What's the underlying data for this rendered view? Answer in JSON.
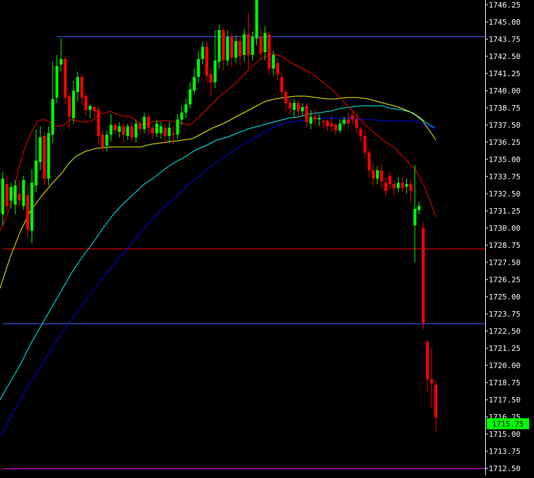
{
  "chart_data": {
    "type": "candlestick",
    "title": "",
    "xlabel": "",
    "ylabel": "",
    "ylim": [
      1712.0,
      1746.6
    ],
    "y_ticks": [
      "1746.25",
      "1745.00",
      "1743.75",
      "1742.50",
      "1741.25",
      "1740.00",
      "1738.75",
      "1737.50",
      "1736.25",
      "1735.00",
      "1733.75",
      "1732.50",
      "1731.25",
      "1730.00",
      "1728.75",
      "1727.50",
      "1726.25",
      "1725.00",
      "1723.75",
      "1722.50",
      "1721.25",
      "1720.00",
      "1718.75",
      "1717.50",
      "1716.25",
      "1715.00",
      "1713.75",
      "1712.50"
    ],
    "last_price": "1715.75",
    "grid": false,
    "colors": {
      "background": "#000000",
      "axis_text": "#ffffff",
      "up_candle": "#00ff00",
      "down_candle": "#ff0000",
      "last_price_bg": "#00ff00",
      "ma_red": "#ff0000",
      "ma_yellow": "#ffff00",
      "ma_cyan": "#00ffff",
      "ma_blue": "#0000ff"
    },
    "horizontal_levels": [
      {
        "value": 1743.95,
        "color": "#4a5cff",
        "start_index": 13
      },
      {
        "value": 1728.5,
        "color": "#ff0000",
        "start_index": 0
      },
      {
        "value": 1723.05,
        "color": "#4a5cff",
        "start_index": 0
      },
      {
        "value": 1712.5,
        "color": "#ff00ff",
        "start_index": 0
      }
    ],
    "candles": [
      [
        1731.0,
        1733.6,
        1730.2,
        1734.1
      ],
      [
        1733.2,
        1731.6,
        1731.2,
        1733.8
      ],
      [
        1732.0,
        1733.0,
        1731.4,
        1733.3
      ],
      [
        1731.7,
        1733.1,
        1731.0,
        1733.5
      ],
      [
        1732.5,
        1732.0,
        1731.6,
        1733.5
      ],
      [
        1731.6,
        1733.5,
        1731.3,
        1733.8
      ],
      [
        1732.4,
        1729.9,
        1729.3,
        1733.1
      ],
      [
        1729.8,
        1733.3,
        1728.9,
        1734.3
      ],
      [
        1733.1,
        1734.9,
        1732.6,
        1737.2
      ],
      [
        1734.8,
        1736.6,
        1734.2,
        1737.4
      ],
      [
        1736.7,
        1733.6,
        1733.1,
        1737.0
      ],
      [
        1733.6,
        1736.9,
        1733.1,
        1737.4
      ],
      [
        1736.8,
        1739.4,
        1736.2,
        1742.1
      ],
      [
        1739.5,
        1741.8,
        1739.1,
        1742.6
      ],
      [
        1741.9,
        1742.3,
        1741.4,
        1743.8
      ],
      [
        1742.3,
        1739.5,
        1739.0,
        1742.5
      ],
      [
        1739.6,
        1738.1,
        1737.2,
        1739.9
      ],
      [
        1738.0,
        1740.0,
        1737.6,
        1740.7
      ],
      [
        1739.9,
        1741.0,
        1739.2,
        1741.4
      ],
      [
        1741.0,
        1739.5,
        1739.0,
        1741.2
      ],
      [
        1739.6,
        1738.6,
        1738.2,
        1739.8
      ],
      [
        1738.6,
        1738.9,
        1738.0,
        1739.0
      ],
      [
        1738.8,
        1738.5,
        1738.1,
        1738.9
      ],
      [
        1738.6,
        1736.7,
        1736.1,
        1738.9
      ],
      [
        1736.8,
        1735.9,
        1735.6,
        1737.1
      ],
      [
        1736.0,
        1736.8,
        1735.6,
        1737.1
      ],
      [
        1736.8,
        1737.5,
        1736.3,
        1738.3
      ],
      [
        1737.5,
        1737.1,
        1736.8,
        1737.6
      ],
      [
        1737.0,
        1737.4,
        1736.6,
        1737.7
      ],
      [
        1737.4,
        1736.8,
        1736.2,
        1737.6
      ],
      [
        1736.7,
        1737.4,
        1736.4,
        1737.6
      ],
      [
        1737.4,
        1736.6,
        1736.3,
        1737.7
      ],
      [
        1736.6,
        1737.6,
        1736.2,
        1737.9
      ],
      [
        1737.6,
        1737.2,
        1736.8,
        1737.8
      ],
      [
        1737.2,
        1738.1,
        1736.9,
        1738.4
      ],
      [
        1738.1,
        1737.3,
        1736.8,
        1738.3
      ],
      [
        1737.3,
        1736.9,
        1736.5,
        1737.5
      ],
      [
        1736.9,
        1737.6,
        1736.6,
        1737.9
      ],
      [
        1736.9,
        1737.4,
        1736.5,
        1737.7
      ],
      [
        1737.3,
        1736.7,
        1736.2,
        1737.6
      ],
      [
        1736.7,
        1737.3,
        1736.2,
        1737.7
      ],
      [
        1736.9,
        1736.8,
        1736.1,
        1737.4
      ],
      [
        1736.8,
        1737.9,
        1736.5,
        1738.3
      ],
      [
        1737.9,
        1738.4,
        1737.5,
        1738.9
      ],
      [
        1738.4,
        1739.0,
        1738.0,
        1739.4
      ],
      [
        1739.0,
        1740.1,
        1738.7,
        1740.6
      ],
      [
        1740.0,
        1741.0,
        1739.7,
        1741.6
      ],
      [
        1741.0,
        1742.3,
        1740.6,
        1742.9
      ],
      [
        1742.3,
        1743.2,
        1741.9,
        1743.6
      ],
      [
        1743.2,
        1741.1,
        1740.6,
        1743.6
      ],
      [
        1741.2,
        1740.6,
        1739.6,
        1741.6
      ],
      [
        1740.6,
        1742.2,
        1740.2,
        1744.4
      ],
      [
        1742.1,
        1744.4,
        1741.6,
        1744.8
      ],
      [
        1744.4,
        1742.2,
        1741.5,
        1744.6
      ],
      [
        1742.2,
        1743.9,
        1741.8,
        1744.4
      ],
      [
        1743.9,
        1742.4,
        1741.7,
        1744.2
      ],
      [
        1742.4,
        1743.6,
        1742.0,
        1744.0
      ],
      [
        1743.6,
        1742.5,
        1741.8,
        1744.0
      ],
      [
        1742.6,
        1744.1,
        1742.1,
        1744.5
      ],
      [
        1744.1,
        1742.6,
        1741.6,
        1745.6
      ],
      [
        1742.6,
        1743.9,
        1742.2,
        1744.3
      ],
      [
        1743.8,
        1747.0,
        1743.3,
        1747.1
      ],
      [
        1743.9,
        1742.7,
        1742.3,
        1744.6
      ],
      [
        1742.8,
        1744.2,
        1742.2,
        1744.7
      ],
      [
        1744.1,
        1741.6,
        1741.2,
        1744.3
      ],
      [
        1741.6,
        1742.6,
        1741.1,
        1742.9
      ],
      [
        1742.0,
        1741.2,
        1740.7,
        1742.4
      ],
      [
        1741.0,
        1739.9,
        1739.5,
        1741.3
      ],
      [
        1739.9,
        1739.1,
        1738.5,
        1740.1
      ],
      [
        1739.1,
        1738.7,
        1738.3,
        1739.4
      ],
      [
        1738.6,
        1739.1,
        1738.1,
        1739.4
      ],
      [
        1739.1,
        1738.5,
        1738.0,
        1739.3
      ],
      [
        1738.5,
        1738.8,
        1738.2,
        1739.1
      ],
      [
        1738.9,
        1737.7,
        1737.3,
        1739.1
      ],
      [
        1737.6,
        1738.1,
        1737.2,
        1738.6
      ],
      [
        1738.1,
        1737.9,
        1737.5,
        1738.6
      ],
      [
        1737.9,
        1738.0,
        1737.4,
        1738.3
      ],
      [
        1737.8,
        1737.7,
        1737.3,
        1737.9
      ],
      [
        1737.8,
        1737.4,
        1737.1,
        1737.9
      ],
      [
        1737.6,
        1737.4,
        1737.0,
        1738.2
      ],
      [
        1737.5,
        1737.1,
        1736.8,
        1737.7
      ],
      [
        1737.1,
        1737.6,
        1736.9,
        1737.9
      ],
      [
        1737.6,
        1737.9,
        1737.4,
        1738.1
      ],
      [
        1737.9,
        1737.6,
        1737.3,
        1738.4
      ],
      [
        1738.2,
        1737.9,
        1737.6,
        1738.5
      ],
      [
        1737.9,
        1737.3,
        1736.9,
        1738.3
      ],
      [
        1737.2,
        1736.7,
        1736.3,
        1737.4
      ],
      [
        1736.7,
        1735.5,
        1735.1,
        1737.1
      ],
      [
        1735.5,
        1734.2,
        1733.7,
        1735.7
      ],
      [
        1734.2,
        1733.6,
        1733.1,
        1734.7
      ],
      [
        1733.6,
        1734.2,
        1733.2,
        1734.5
      ],
      [
        1734.2,
        1733.4,
        1732.9,
        1734.6
      ],
      [
        1733.3,
        1732.7,
        1732.3,
        1733.7
      ],
      [
        1733.8,
        1733.2,
        1732.8,
        1734.1
      ],
      [
        1733.2,
        1732.9,
        1732.4,
        1733.5
      ],
      [
        1732.9,
        1733.3,
        1732.6,
        1733.7
      ],
      [
        1733.3,
        1732.9,
        1732.6,
        1733.7
      ],
      [
        1733.0,
        1733.2,
        1732.5,
        1733.6
      ],
      [
        1733.2,
        1732.7,
        1731.8,
        1733.6
      ],
      [
        1730.2,
        1731.4,
        1727.5,
        1734.6
      ],
      [
        1731.3,
        1731.6,
        1731.0,
        1731.9
      ],
      [
        1730.0,
        1723.1,
        1722.6,
        1730.4
      ],
      [
        1721.7,
        1719.0,
        1718.1,
        1721.9
      ],
      [
        1719.0,
        1718.7,
        1716.9,
        1721.3
      ],
      [
        1718.6,
        1716.2,
        1715.2,
        1718.9
      ]
    ],
    "ma_red": [
      [
        0,
        1729.8
      ],
      [
        6,
        1730.4
      ],
      [
        13,
        1731.3
      ],
      [
        20,
        1732.7
      ],
      [
        27,
        1734.3
      ],
      [
        35,
        1735.7
      ],
      [
        45,
        1736.9
      ],
      [
        55,
        1737.8
      ],
      [
        63,
        1737.9
      ],
      [
        73,
        1737.7
      ],
      [
        82,
        1737.4
      ],
      [
        93,
        1737.5
      ],
      [
        103,
        1737.9
      ],
      [
        112,
        1737.8
      ],
      [
        122,
        1737.7
      ],
      [
        133,
        1737.8
      ],
      [
        145,
        1738.3
      ],
      [
        160,
        1738.5
      ],
      [
        175,
        1738.2
      ],
      [
        190,
        1738.1
      ],
      [
        200,
        1737.7
      ],
      [
        210,
        1737.5
      ],
      [
        220,
        1737.7
      ],
      [
        235,
        1737.8
      ],
      [
        250,
        1737.8
      ],
      [
        265,
        1737.6
      ],
      [
        277,
        1737.5
      ],
      [
        292,
        1738.2
      ],
      [
        306,
        1738.9
      ],
      [
        320,
        1739.6
      ],
      [
        335,
        1740.2
      ],
      [
        350,
        1740.9
      ],
      [
        365,
        1741.7
      ],
      [
        380,
        1742.3
      ],
      [
        395,
        1742.7
      ],
      [
        410,
        1742.5
      ],
      [
        425,
        1742.0
      ],
      [
        440,
        1741.6
      ],
      [
        455,
        1741.2
      ],
      [
        470,
        1740.6
      ],
      [
        485,
        1740.0
      ],
      [
        500,
        1739.2
      ],
      [
        515,
        1738.4
      ],
      [
        530,
        1737.6
      ],
      [
        545,
        1736.9
      ],
      [
        560,
        1736.3
      ],
      [
        575,
        1735.8
      ],
      [
        590,
        1735.0
      ],
      [
        605,
        1734.2
      ],
      [
        618,
        1733.0
      ],
      [
        627,
        1731.8
      ],
      [
        634,
        1730.8
      ]
    ],
    "ma_yellow": [
      [
        0,
        1725.6
      ],
      [
        15,
        1727.9
      ],
      [
        30,
        1729.8
      ],
      [
        45,
        1731.3
      ],
      [
        60,
        1732.3
      ],
      [
        75,
        1733.2
      ],
      [
        90,
        1734.0
      ],
      [
        100,
        1734.7
      ],
      [
        110,
        1735.2
      ],
      [
        125,
        1735.6
      ],
      [
        140,
        1735.8
      ],
      [
        160,
        1735.9
      ],
      [
        175,
        1735.9
      ],
      [
        190,
        1735.9
      ],
      [
        205,
        1735.9
      ],
      [
        220,
        1736.1
      ],
      [
        235,
        1736.2
      ],
      [
        250,
        1736.3
      ],
      [
        265,
        1736.4
      ],
      [
        280,
        1736.5
      ],
      [
        295,
        1736.9
      ],
      [
        310,
        1737.3
      ],
      [
        325,
        1737.6
      ],
      [
        340,
        1738.0
      ],
      [
        355,
        1738.4
      ],
      [
        370,
        1738.8
      ],
      [
        385,
        1739.2
      ],
      [
        400,
        1739.4
      ],
      [
        415,
        1739.5
      ],
      [
        430,
        1739.6
      ],
      [
        445,
        1739.6
      ],
      [
        460,
        1739.5
      ],
      [
        475,
        1739.4
      ],
      [
        490,
        1739.4
      ],
      [
        505,
        1739.5
      ],
      [
        520,
        1739.5
      ],
      [
        535,
        1739.4
      ],
      [
        550,
        1739.2
      ],
      [
        565,
        1739.0
      ],
      [
        580,
        1738.8
      ],
      [
        595,
        1738.5
      ],
      [
        605,
        1738.2
      ],
      [
        615,
        1737.8
      ],
      [
        622,
        1737.3
      ],
      [
        629,
        1736.8
      ],
      [
        634,
        1736.4
      ]
    ],
    "ma_cyan": [
      [
        0,
        1717.5
      ],
      [
        15,
        1718.8
      ],
      [
        30,
        1720.1
      ],
      [
        45,
        1721.6
      ],
      [
        60,
        1722.9
      ],
      [
        75,
        1724.2
      ],
      [
        90,
        1725.5
      ],
      [
        105,
        1726.8
      ],
      [
        120,
        1727.9
      ],
      [
        135,
        1728.9
      ],
      [
        150,
        1730.0
      ],
      [
        165,
        1731.0
      ],
      [
        180,
        1731.8
      ],
      [
        195,
        1732.5
      ],
      [
        210,
        1733.2
      ],
      [
        225,
        1733.7
      ],
      [
        240,
        1734.3
      ],
      [
        255,
        1734.8
      ],
      [
        270,
        1735.2
      ],
      [
        285,
        1735.7
      ],
      [
        300,
        1736.0
      ],
      [
        315,
        1736.4
      ],
      [
        330,
        1736.6
      ],
      [
        345,
        1736.9
      ],
      [
        360,
        1737.2
      ],
      [
        375,
        1737.4
      ],
      [
        390,
        1737.6
      ],
      [
        405,
        1737.8
      ],
      [
        420,
        1738.0
      ],
      [
        435,
        1738.1
      ],
      [
        450,
        1738.3
      ],
      [
        465,
        1738.4
      ],
      [
        480,
        1738.5
      ],
      [
        495,
        1738.7
      ],
      [
        510,
        1738.8
      ],
      [
        525,
        1738.9
      ],
      [
        540,
        1738.9
      ],
      [
        555,
        1738.9
      ],
      [
        570,
        1738.7
      ],
      [
        585,
        1738.6
      ],
      [
        600,
        1738.4
      ],
      [
        612,
        1738.0
      ],
      [
        622,
        1737.6
      ],
      [
        632,
        1737.3
      ]
    ],
    "ma_blue": [
      [
        0,
        1714.8
      ],
      [
        15,
        1716.2
      ],
      [
        30,
        1717.5
      ],
      [
        45,
        1718.8
      ],
      [
        60,
        1720.0
      ],
      [
        75,
        1721.2
      ],
      [
        90,
        1722.4
      ],
      [
        105,
        1723.4
      ],
      [
        120,
        1724.4
      ],
      [
        135,
        1725.4
      ],
      [
        150,
        1726.4
      ],
      [
        165,
        1727.3
      ],
      [
        180,
        1728.2
      ],
      [
        195,
        1729.1
      ],
      [
        210,
        1730.0
      ],
      [
        225,
        1730.8
      ],
      [
        240,
        1731.6
      ],
      [
        255,
        1732.2
      ],
      [
        270,
        1733.0
      ],
      [
        285,
        1733.6
      ],
      [
        300,
        1734.2
      ],
      [
        315,
        1734.8
      ],
      [
        330,
        1735.3
      ],
      [
        345,
        1735.8
      ],
      [
        360,
        1736.3
      ],
      [
        375,
        1736.7
      ],
      [
        390,
        1737.1
      ],
      [
        405,
        1737.5
      ],
      [
        420,
        1737.7
      ],
      [
        435,
        1737.8
      ],
      [
        450,
        1737.9
      ],
      [
        465,
        1738.0
      ],
      [
        480,
        1738.0
      ],
      [
        495,
        1738.0
      ],
      [
        510,
        1738.0
      ],
      [
        525,
        1737.9
      ],
      [
        540,
        1737.9
      ],
      [
        555,
        1737.8
      ],
      [
        570,
        1737.8
      ],
      [
        585,
        1737.8
      ],
      [
        600,
        1737.8
      ],
      [
        612,
        1737.7
      ],
      [
        624,
        1737.4
      ],
      [
        634,
        1737.2
      ]
    ]
  }
}
